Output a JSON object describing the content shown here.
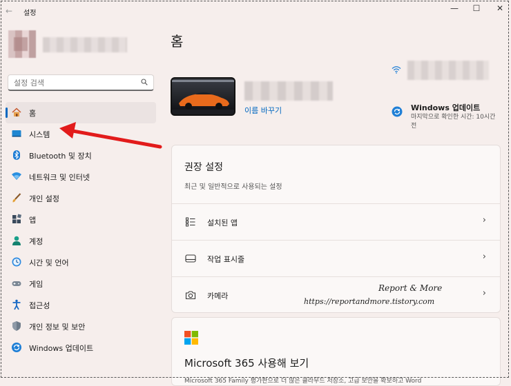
{
  "window": {
    "title": "설정",
    "back_glyph": "←",
    "minimize_glyph": "—",
    "maximize_glyph": "☐",
    "close_glyph": "✕"
  },
  "search": {
    "placeholder": "설정 검색"
  },
  "sidebar": {
    "items": [
      {
        "label": "홈",
        "icon": "home-icon",
        "active": true
      },
      {
        "label": "시스템",
        "icon": "system-icon"
      },
      {
        "label": "Bluetooth 및 장치",
        "icon": "bluetooth-icon"
      },
      {
        "label": "네트워크 및 인터넷",
        "icon": "network-icon"
      },
      {
        "label": "개인 설정",
        "icon": "brush-icon"
      },
      {
        "label": "앱",
        "icon": "apps-icon"
      },
      {
        "label": "계정",
        "icon": "account-icon"
      },
      {
        "label": "시간 및 언어",
        "icon": "clock-globe-icon"
      },
      {
        "label": "게임",
        "icon": "gamepad-icon"
      },
      {
        "label": "접근성",
        "icon": "accessibility-icon"
      },
      {
        "label": "개인 정보 및 보안",
        "icon": "shield-icon"
      },
      {
        "label": "Windows 업데이트",
        "icon": "update-icon"
      }
    ]
  },
  "main": {
    "title": "홈",
    "rename_link": "이름 바꾸기",
    "update": {
      "title": "Windows 업데이트",
      "subtitle": "마지막으로 확인한 시간: 10시간 전"
    },
    "recommended": {
      "title": "권장 설정",
      "subtitle": "최근 및 일반적으로 사용되는 설정",
      "rows": [
        {
          "label": "설치된 앱",
          "icon": "list-icon"
        },
        {
          "label": "작업 표시줄",
          "icon": "taskbar-icon"
        },
        {
          "label": "카메라",
          "icon": "camera-icon"
        }
      ],
      "chevron": "›"
    },
    "ms365": {
      "title": "Microsoft 365 사용해 보기",
      "subtitle": "Microsoft 365 Family 평가판으로 더 많은 클라우드 저장소, 고급 보안을 확보하고 Word"
    }
  },
  "watermark": {
    "line1": "Report & More",
    "line2": "https://reportandmore.tistory.com"
  },
  "colors": {
    "accent": "#0067c0",
    "arrow": "#e21b1b"
  }
}
